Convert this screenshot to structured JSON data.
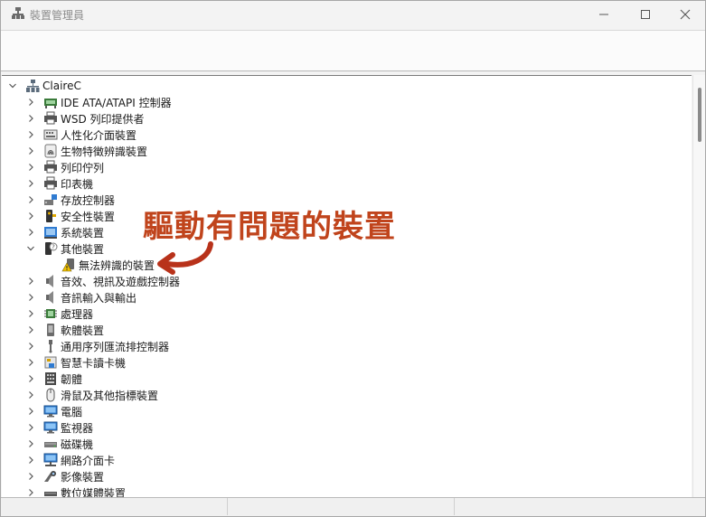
{
  "window": {
    "title": "裝置管理員",
    "minimize_glyph": "—",
    "maximize_glyph": "☐",
    "close_glyph": "✕"
  },
  "tree": {
    "root": {
      "label": "ClaireC",
      "expanded": true,
      "icon": "computer-icon"
    },
    "items": [
      {
        "label": "IDE ATA/ATAPI 控制器",
        "icon": "ide-controller-icon",
        "expanded": false
      },
      {
        "label": "WSD 列印提供者",
        "icon": "printer-icon",
        "expanded": false
      },
      {
        "label": "人性化介面裝置",
        "icon": "hid-icon",
        "expanded": false
      },
      {
        "label": "生物特徵辨識裝置",
        "icon": "fingerprint-icon",
        "expanded": false
      },
      {
        "label": "列印佇列",
        "icon": "printer-icon",
        "expanded": false
      },
      {
        "label": "印表機",
        "icon": "printer-icon",
        "expanded": false
      },
      {
        "label": "存放控制器",
        "icon": "storage-controller-icon",
        "expanded": false
      },
      {
        "label": "安全性裝置",
        "icon": "security-key-icon",
        "expanded": false
      },
      {
        "label": "系統裝置",
        "icon": "system-device-icon",
        "expanded": false
      },
      {
        "label": "其他裝置",
        "icon": "unknown-device-icon",
        "expanded": true,
        "children": [
          {
            "label": "無法辨識的裝置",
            "icon": "warning-device-icon"
          }
        ]
      },
      {
        "label": "音效、視訊及遊戲控制器",
        "icon": "speaker-icon",
        "expanded": false
      },
      {
        "label": "音訊輸入與輸出",
        "icon": "speaker-icon",
        "expanded": false
      },
      {
        "label": "處理器",
        "icon": "processor-icon",
        "expanded": false
      },
      {
        "label": "軟體裝置",
        "icon": "software-device-icon",
        "expanded": false
      },
      {
        "label": "通用序列匯流排控制器",
        "icon": "usb-icon",
        "expanded": false
      },
      {
        "label": "智慧卡讀卡機",
        "icon": "smartcard-icon",
        "expanded": false
      },
      {
        "label": "韌體",
        "icon": "firmware-icon",
        "expanded": false
      },
      {
        "label": "滑鼠及其他指標裝置",
        "icon": "mouse-icon",
        "expanded": false
      },
      {
        "label": "電腦",
        "icon": "monitor-icon",
        "expanded": false
      },
      {
        "label": "監視器",
        "icon": "monitor-icon",
        "expanded": false
      },
      {
        "label": "磁碟機",
        "icon": "disk-drive-icon",
        "expanded": false
      },
      {
        "label": "網路介面卡",
        "icon": "network-adapter-icon",
        "expanded": false
      },
      {
        "label": "影像裝置",
        "icon": "camera-icon",
        "expanded": false
      },
      {
        "label": "數位媒體裝置",
        "icon": "media-device-icon",
        "expanded": false
      }
    ]
  },
  "annotation": {
    "text": "驅動有問題的裝置",
    "color": "#c0441c"
  },
  "colors": {
    "annotation": "#c0441c",
    "warning": "#f2c200"
  }
}
